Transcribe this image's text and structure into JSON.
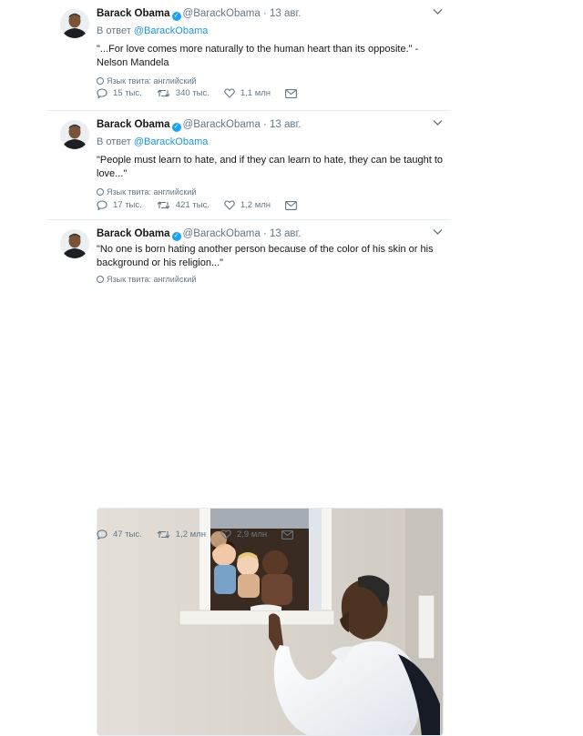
{
  "tweets": [
    {
      "author": {
        "name": "Barack Obama",
        "handle": "@BarackObama",
        "date": "13 авг."
      },
      "reply": {
        "prefix": "В ответ",
        "to": "@BarackObama"
      },
      "text": "\"...For love comes more naturally to the human heart than its opposite.\" - Nelson Mandela",
      "language": "Язык твита: английский",
      "stats": {
        "replies": "15 тыс.",
        "retweets": "340 тыс.",
        "likes": "1,1 млн"
      }
    },
    {
      "author": {
        "name": "Barack Obama",
        "handle": "@BarackObama",
        "date": "13 авг."
      },
      "reply": {
        "prefix": "В ответ",
        "to": "@BarackObama"
      },
      "text": "\"People must learn to hate, and if they can learn to hate, they can be taught to love...\"",
      "language": "Язык твита: английский",
      "stats": {
        "replies": "17 тыс.",
        "retweets": "421 тыс.",
        "likes": "1,2 млн"
      }
    },
    {
      "author": {
        "name": "Barack Obama",
        "handle": "@BarackObama",
        "date": "13 авг."
      },
      "text": "\"No one is born hating another person because of the color of his skin or his background or his religion...\"",
      "language": "Язык твита: английский",
      "stats": {
        "replies": "47 тыс.",
        "retweets": "1,2 млн",
        "likes": "2,9 млн"
      }
    }
  ],
  "icons": {
    "verified": "verified-badge-icon",
    "reply": "reply-icon",
    "retweet": "retweet-icon",
    "like": "heart-icon",
    "message": "envelope-icon",
    "more": "chevron-down-icon",
    "language": "globe-icon"
  },
  "colors": {
    "link": "#1b95e0",
    "verified": "#1da1f2",
    "muted": "#657786"
  }
}
